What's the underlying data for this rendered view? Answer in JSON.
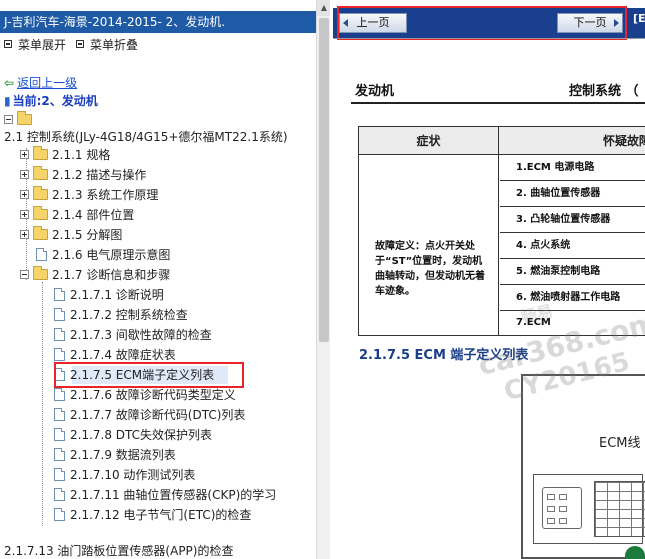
{
  "left_pane": {
    "title": "J-吉利汽车-海景-2014-2015- 2、发动机.",
    "menu_expand": "菜单展开",
    "menu_collapse": "菜单折叠",
    "back_link": "返回上一级",
    "current_label": "当前:2、发动机",
    "tree": [
      {
        "label": "2.1 控制系统(JLy-4G18/4G15+德尔福MT22.1系统)",
        "kind": "section"
      },
      {
        "label": "2.1.1 规格",
        "kind": "folder",
        "expanded": false
      },
      {
        "label": "2.1.2 描述与操作",
        "kind": "folder",
        "expanded": false
      },
      {
        "label": "2.1.3 系统工作原理",
        "kind": "folder",
        "expanded": false
      },
      {
        "label": "2.1.4 部件位置",
        "kind": "folder",
        "expanded": false
      },
      {
        "label": "2.1.5 分解图",
        "kind": "folder",
        "expanded": false
      },
      {
        "label": "2.1.6 电气原理示意图",
        "kind": "doc"
      },
      {
        "label": "2.1.7 诊断信息和步骤",
        "kind": "folder",
        "expanded": true
      },
      {
        "label": "2.1.7.1 诊断说明",
        "kind": "doc"
      },
      {
        "label": "2.1.7.2 控制系统检查",
        "kind": "doc"
      },
      {
        "label": "2.1.7.3 间歇性故障的检查",
        "kind": "doc"
      },
      {
        "label": "2.1.7.4 故障症状表",
        "kind": "doc"
      },
      {
        "label": "2.1.7.5 ECM端子定义列表",
        "kind": "doc",
        "selected": true
      },
      {
        "label": "2.1.7.6 故障诊断代码类型定义",
        "kind": "doc"
      },
      {
        "label": "2.1.7.7 故障诊断代码(DTC)列表",
        "kind": "doc"
      },
      {
        "label": "2.1.7.8 DTC失效保护列表",
        "kind": "doc"
      },
      {
        "label": "2.1.7.9 数据流列表",
        "kind": "doc"
      },
      {
        "label": "2.1.7.10 动作测试列表",
        "kind": "doc"
      },
      {
        "label": "2.1.7.11 曲轴位置传感器(CKP)的学习",
        "kind": "doc"
      },
      {
        "label": "2.1.7.12 电子节气门(ETC)的检查",
        "kind": "doc"
      },
      {
        "label": "2.1.7.13 油门踏板位置传感器(APP)的检查",
        "kind": "doc"
      }
    ]
  },
  "right_pane": {
    "prev_button": "上一页",
    "next_button": "下一页",
    "bar_overflow_text": "[E",
    "doc_left_label": "发动机",
    "doc_right_label": "控制系统 （",
    "table": {
      "header_symptom": "症状",
      "header_cause": "怀疑故障项",
      "symptom_text": "故障定义：点火开关处于“ST”位置时，发动机曲轴转动，但发动机无着车迹象。",
      "causes": [
        "1.ECM 电源电路",
        "2. 曲轴位置传感器",
        "3. 凸轮轴位置传感器",
        "4. 点火系统",
        "5. 燃油泵控制电路",
        "6. 燃油喷射器工作电路",
        "7.ECM"
      ]
    },
    "section_title": "2.1.7.5  ECM 端子定义列表",
    "diagram_label": "ECM线",
    "watermarks": [
      "car368.com",
      "CY20165",
      "畅易"
    ]
  },
  "colors": {
    "title_bar": "#1f5aa6",
    "nav_bar": "#1a3f8f",
    "highlight_red": "#e8252a",
    "link_blue": "#1a4fd6",
    "section_blue": "#1a3e8a"
  }
}
